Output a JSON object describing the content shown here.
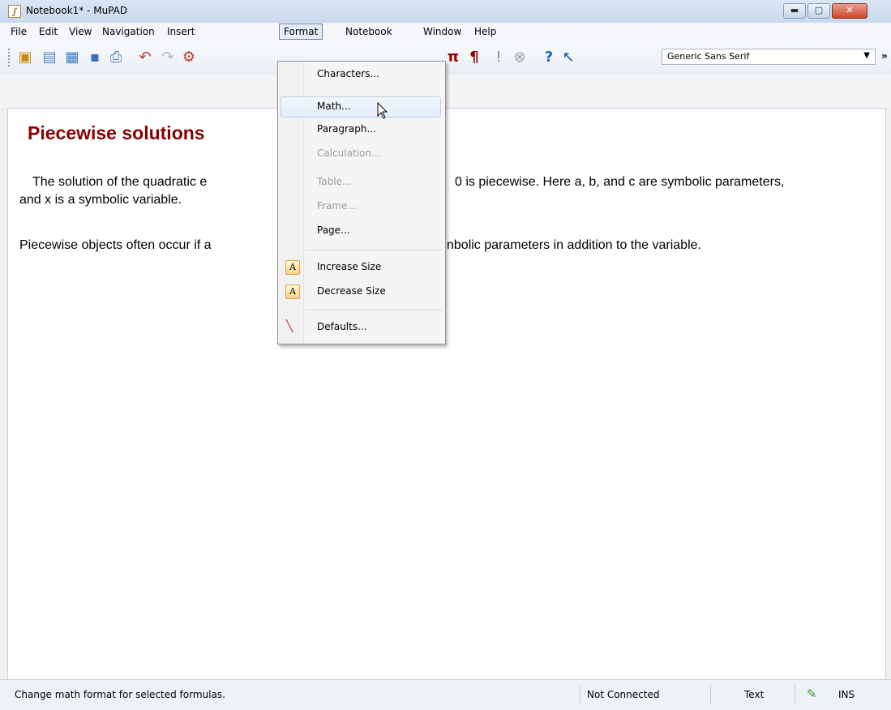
{
  "window": {
    "title": "Notebook1* - MuPAD",
    "app_icon": "mupad-icon"
  },
  "window_controls": {
    "minimize": "▬",
    "maximize": "▢",
    "close": "✕"
  },
  "menubar": {
    "items": [
      "File",
      "Edit",
      "View",
      "Navigation",
      "Insert",
      "Format",
      "Notebook",
      "Window",
      "Help"
    ],
    "active": "Format"
  },
  "toolbar": {
    "icons": [
      "new-notebook-icon",
      "new-editor-icon",
      "open-icon",
      "save-icon",
      "print-icon",
      "undo-icon",
      "redo-icon",
      "calculation-icon",
      "insert-math-icon",
      "paragraph-icon",
      "warning-icon",
      "stop-icon",
      "help-icon",
      "context-help-icon"
    ],
    "font_value": "Generic Sans Serif",
    "overflow": "»"
  },
  "document": {
    "heading": "Piecewise solutions",
    "para1_line1_a": "The solution of the quadratic e",
    "para1_line1_b": "0 is piecewise. Here a, b, and c  are symbolic parameters,",
    "para1_line2": "and x is a symbolic variable.",
    "para2_a": "Piecewise objects often occur if a",
    "para2_b": "nbolic parameters in addition to the variable."
  },
  "format_menu": {
    "items": [
      {
        "label": "Characters...",
        "enabled": true
      },
      {
        "label": "Math...",
        "enabled": true,
        "highlighted": true
      },
      {
        "label": "Paragraph...",
        "enabled": true
      },
      {
        "label": "Calculation...",
        "enabled": false
      },
      {
        "label": "Table...",
        "enabled": false
      },
      {
        "label": "Frame...",
        "enabled": false
      },
      {
        "label": "Page...",
        "enabled": true
      },
      {
        "label": "Increase Size",
        "enabled": true,
        "icon": "increase-size-icon"
      },
      {
        "label": "Decrease Size",
        "enabled": true,
        "icon": "decrease-size-icon"
      },
      {
        "label": "Defaults...",
        "enabled": true,
        "icon": "defaults-icon"
      }
    ]
  },
  "statusbar": {
    "message": "Change math format for selected formulas.",
    "connection": "Not Connected",
    "mode": "Text",
    "insert_mode": "INS"
  }
}
